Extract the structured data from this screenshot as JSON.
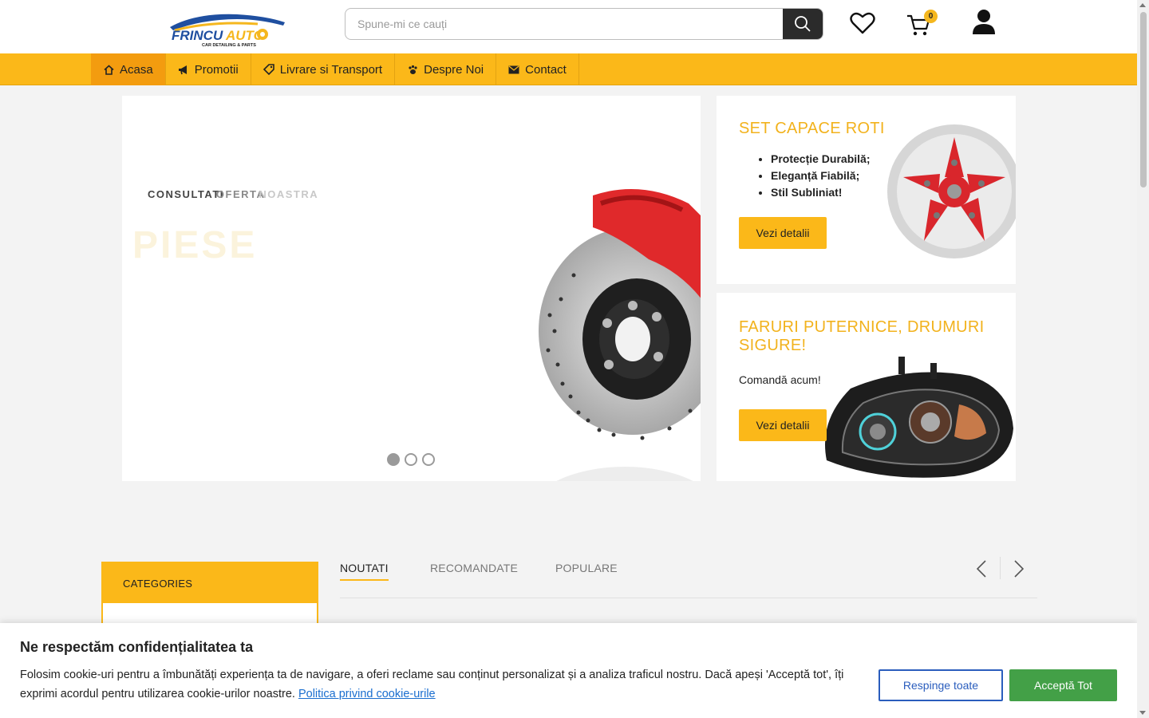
{
  "brand": {
    "logo_name": "FRINCU AUTO",
    "logo_tagline": "CAR DETAILING & PARTS"
  },
  "search": {
    "placeholder": "Spune-mi ce cauți"
  },
  "header": {
    "cart_count": "0"
  },
  "nav": {
    "items": [
      {
        "label": "Acasa",
        "icon": "home-icon"
      },
      {
        "label": "Promotii",
        "icon": "megaphone-icon"
      },
      {
        "label": "Livrare si Transport",
        "icon": "tag-icon"
      },
      {
        "label": "Despre Noi",
        "icon": "paw-icon"
      },
      {
        "label": "Contact",
        "icon": "envelope-icon"
      }
    ]
  },
  "slider": {
    "subtitle_part1": "CONSULTATI",
    "subtitle_part2": "OFERTA",
    "subtitle_part3": "NOASTRA",
    "title": "PIESE",
    "active_slide": 1,
    "slide_count": 3
  },
  "promo1": {
    "title": "SET CAPACE ROTI",
    "bullets": [
      "Protecție Durabilă;",
      "Eleganță Fiabilă;",
      "Stil Subliniat!"
    ],
    "button": "Vezi detalii"
  },
  "promo2": {
    "title": "FARURI PUTERNICE, DRUMURI SIGURE!",
    "text": "Comandă acum!",
    "button": "Vezi detalii"
  },
  "categories": {
    "title": "CATEGORIES"
  },
  "tabs": [
    "NOUTATI",
    "RECOMANDATE",
    "POPULARE"
  ],
  "cookie": {
    "title": "Ne respectăm confidențialitatea ta",
    "text": "Folosim cookie-uri pentru a îmbunătăți experiența ta de navigare, a oferi reclame sau conținut personalizat și a analiza traficul nostru. Dacă apeși 'Acceptă tot', îți exprimi acordul pentru utilizarea cookie-urilor noastre.",
    "link": "Politica privind cookie-urile",
    "reject": "Respinge toate",
    "accept": "Acceptă Tot"
  },
  "colors": {
    "accent": "#fbb819",
    "dark": "#2b2b2b",
    "accept": "#43a047",
    "reject": "#2a5dbd"
  }
}
